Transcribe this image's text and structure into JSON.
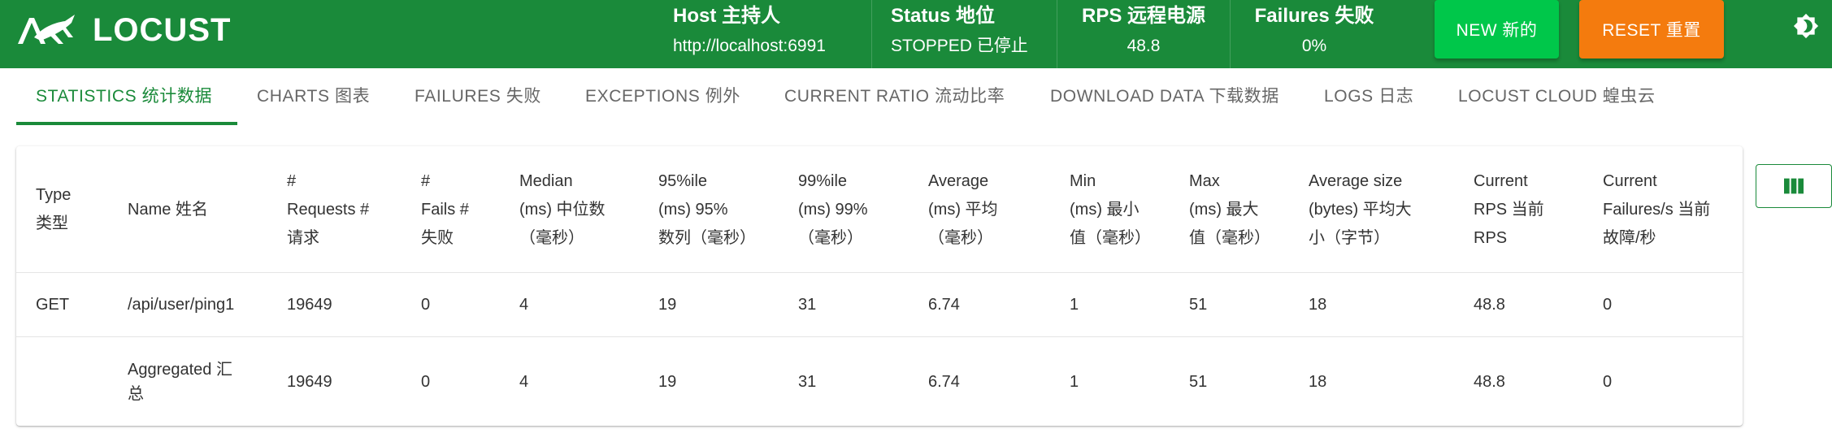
{
  "app": {
    "logo_text": "LOCUST"
  },
  "header": {
    "stats": [
      {
        "label": "Host  主持人",
        "value": "http://localhost:6991"
      },
      {
        "label": "Status  地位",
        "value": "STOPPED  已停止"
      },
      {
        "label": "RPS  远程电源",
        "value": "48.8"
      },
      {
        "label": "Failures  失败",
        "value": "0%"
      }
    ],
    "new_button": "NEW  新的",
    "reset_button": "RESET  重置"
  },
  "tabs": [
    "STATISTICS  统计数据",
    "CHARTS  图表",
    "FAILURES  失败",
    "EXCEPTIONS  例外",
    "CURRENT RATIO  流动比率",
    "DOWNLOAD DATA  下载数据",
    "LOGS  日志",
    "LOCUST CLOUD  蝗虫云"
  ],
  "table": {
    "headers": [
      [
        "Type",
        "类型"
      ],
      [
        "Name  姓名"
      ],
      [
        "#",
        "Requests  #",
        "请求"
      ],
      [
        "#",
        "Fails  #",
        "失败"
      ],
      [
        "Median",
        "(ms)  中位数",
        "（毫秒）"
      ],
      [
        "95%ile",
        "(ms)  95%",
        "数列（毫秒）"
      ],
      [
        "99%ile",
        "(ms)  99%",
        "（毫秒）"
      ],
      [
        "Average",
        "(ms)  平均",
        "（毫秒）"
      ],
      [
        "Min",
        "(ms)  最小",
        "值（毫秒）"
      ],
      [
        "Max",
        "(ms)  最大",
        "值（毫秒）"
      ],
      [
        "Average size",
        "(bytes)  平均大",
        "小（字节）"
      ],
      [
        "Current",
        "RPS  当前",
        "RPS"
      ],
      [
        "Current",
        "Failures/s  当前",
        "故障/秒"
      ]
    ],
    "rows": [
      [
        "GET",
        "/api/user/ping1",
        "19649",
        "0",
        "4",
        "19",
        "31",
        "6.74",
        "1",
        "51",
        "18",
        "48.8",
        "0"
      ],
      [
        "",
        "Aggregated  汇\n总",
        "19649",
        "0",
        "4",
        "19",
        "31",
        "6.74",
        "1",
        "51",
        "18",
        "48.8",
        "0"
      ]
    ],
    "row2_name_lines": [
      "Aggregated  汇",
      "总"
    ]
  },
  "colors": {
    "header_bg": "#1a8a3a",
    "new_button": "#00c74a",
    "reset_button": "#f47b0e",
    "active_tab": "#1a8a3a"
  },
  "icons": {
    "logo": "locust-logo-icon",
    "theme": "brightness-icon",
    "columns": "view-column-icon"
  }
}
